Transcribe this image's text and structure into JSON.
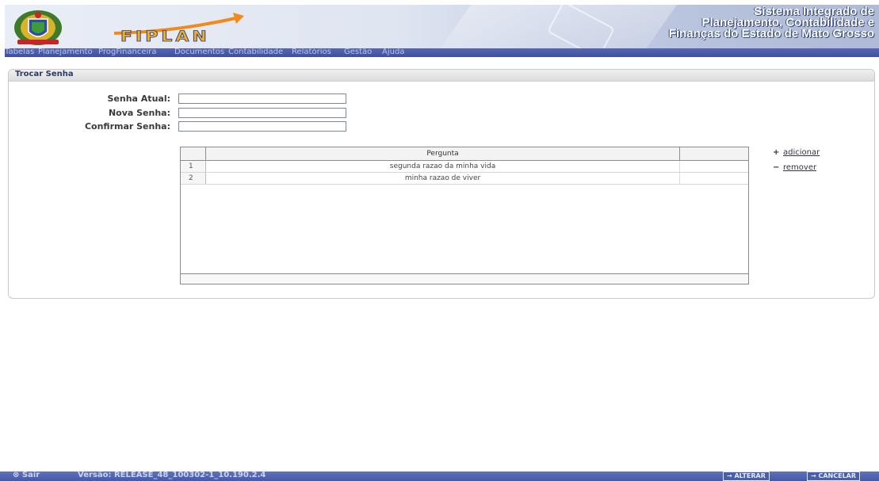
{
  "header": {
    "logo_text": "FIPLAN",
    "system_title": [
      "Sistema Integrado de",
      "Planejamento, Contabilidade e",
      "Finanças do Estado de Mato Grosso"
    ]
  },
  "menu": [
    "Tabelas",
    "Planejamento",
    "ProgFinanceira",
    "Documentos",
    "Contabilidade",
    "Relatórios",
    "Gestão",
    "Ajuda"
  ],
  "panel": {
    "title": "Trocar Senha",
    "fields": {
      "current_password": {
        "label": "Senha Atual:",
        "value": ""
      },
      "new_password": {
        "label": "Nova Senha:",
        "value": ""
      },
      "confirm_password": {
        "label": "Confirmar Senha:",
        "value": ""
      }
    },
    "grid": {
      "column_header": "Pergunta",
      "rows": [
        {
          "num": "1",
          "question": "segunda razao da minha vida"
        },
        {
          "num": "2",
          "question": "minha razao de viver"
        }
      ]
    },
    "actions": {
      "add": "adicionar",
      "remove": "remover"
    }
  },
  "status_bar": {
    "exit": "Sair",
    "version": "Versão: RELEASE_48_100302-1_10.190.2.4",
    "alter_button": "→ ALTERAR",
    "cancel_button": "→ CANCELAR"
  },
  "colors": {
    "menu_bg": "#4a5aa8",
    "accent": "#f2b01e",
    "status_bg": "#5264b0"
  }
}
